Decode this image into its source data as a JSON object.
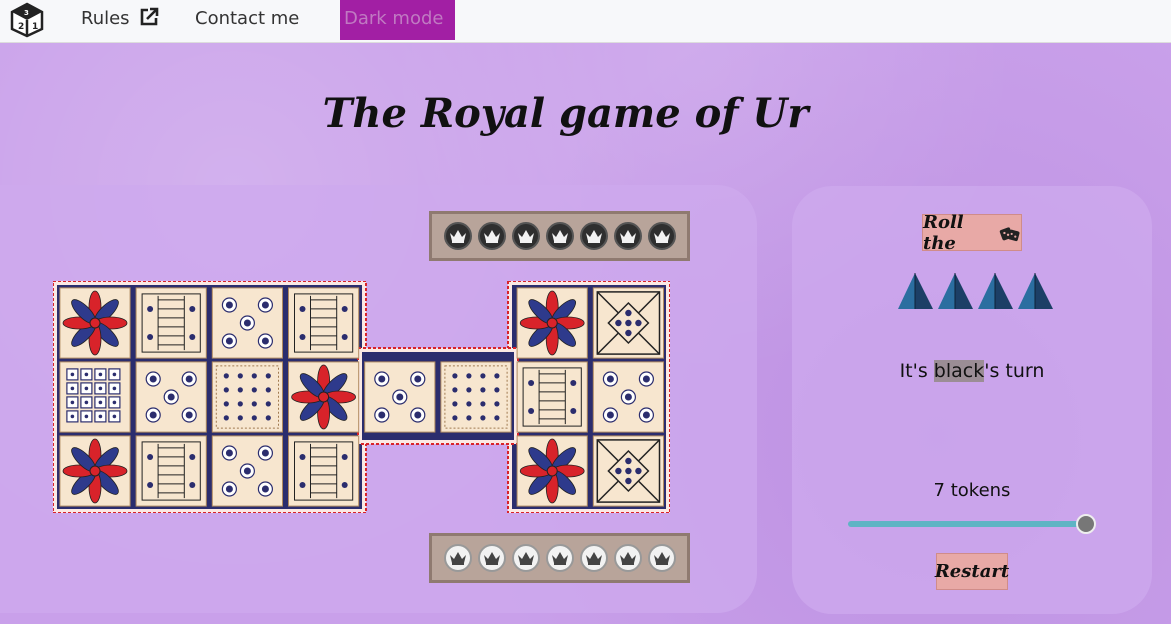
{
  "nav": {
    "logo_icon": "dice-logo-icon",
    "rules_label": "Rules",
    "rules_icon": "external-link-icon",
    "contact_label": "Contact me",
    "dark_mode_label": "Dark mode"
  },
  "title": "The Royal game of Ur",
  "trays": {
    "top": {
      "player": "black",
      "count": 7
    },
    "bottom": {
      "player": "white",
      "count": 7
    }
  },
  "game": {
    "roll_label": "Roll the",
    "roll_icon": "dice-icon",
    "dice_count": 4,
    "turn_prefix": "It's ",
    "turn_player": "black",
    "turn_suffix": "'s turn",
    "tokens_label": "7 tokens",
    "tokens_value": 7,
    "tokens_max": 7,
    "restart_label": "Restart"
  },
  "colors": {
    "background": "#c9a0ea",
    "dark_mode_bg": "#a21fa4",
    "button": "#e8a9a6",
    "slider": "#5fb4c4",
    "board_navy": "#2b2d6e",
    "rosette_red": "#d8232a"
  }
}
